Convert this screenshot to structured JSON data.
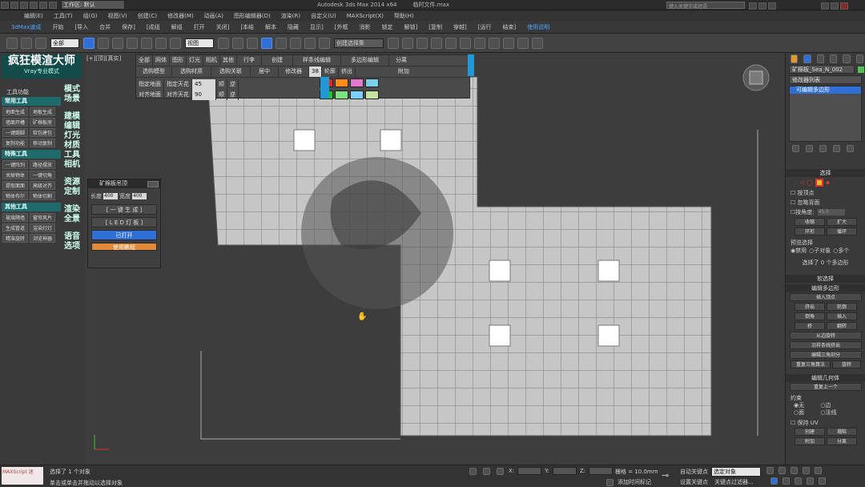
{
  "titlebar": {
    "workspace": "工作区: 默认",
    "app": "Autodesk 3ds Max  2014 x64",
    "file": "临时文件.max",
    "search_placeholder": "键入关键字或短语"
  },
  "menu": [
    "编辑(E)",
    "工具(T)",
    "组(G)",
    "视图(V)",
    "创建(C)",
    "修改器(M)",
    "动画(A)",
    "图形编辑器(D)",
    "渲染(R)",
    "自定义(U)",
    "MAXScript(X)",
    "帮助(H)"
  ],
  "ribbon": [
    "开始",
    "[导入",
    "合并",
    "保存]",
    "[成组",
    "解组",
    "打开",
    "关闭]",
    "[本结",
    "解本",
    "隐藏",
    "显示]",
    "[外框",
    "消影",
    "锁定",
    "解锁]",
    "[复制",
    "穿越]",
    "[运行",
    "结束]"
  ],
  "ribbon_brand": "3dMax速成",
  "ribbon_extra": "使用说明",
  "toolbar": {
    "filter": "全部",
    "ref": "视图",
    "selset": "创建选择集"
  },
  "brand": {
    "title": "疯狂模渲大师",
    "subtitle": "Vray专业模式"
  },
  "leftpanel": {
    "header": "工具功能",
    "sections": [
      {
        "title": "常用工具",
        "items": [
          "地面生成",
          "地板生成",
          "墙面开槽",
          "矿棉板房",
          "一键踢脚",
          "软包建包",
          "复制功能",
          "移动复制"
        ]
      },
      {
        "title": "特殊工具",
        "items": [
          "一键阵列",
          "路径摆放",
          "关联物体",
          "一键切角",
          "提取面面",
          "高级对齐",
          "物体布尔",
          "物体切割"
        ]
      },
      {
        "title": "其他工具",
        "items": [
          "玻璃隔墙",
          "窗帘风片",
          "生成管道",
          "渲染灯灯",
          "精准旋转",
          "浏览神器"
        ]
      }
    ],
    "tabs": [
      "模式\n场景",
      "建模\n编辑\n灯光\n材质\n工具\n相机",
      "资源\n定制",
      "渲染\n全景",
      "语音\n选项"
    ]
  },
  "viewport": {
    "label": "[+][顶][真实]"
  },
  "floattoolbar": {
    "row1": [
      "全部",
      "网体",
      "图形",
      "灯光",
      "相机",
      "其他",
      "行李",
      "创建",
      "样条线编辑",
      "多边形编辑",
      "分离"
    ],
    "row2": [
      "选购模型",
      "选购材质",
      "选购关联",
      "居中",
      "修改器",
      "38",
      "轮廓",
      "挤出",
      "附加"
    ],
    "row3a": [
      "指定地面",
      "指定天花",
      "45",
      "顺",
      "逆"
    ],
    "row3b": [
      "对齐地面",
      "对齐天花",
      "90",
      "顺",
      "逆"
    ],
    "swatches": [
      "#ff2020",
      "#ff8c1a",
      "#e07ad0",
      "#7ad0e6",
      "#20cc20",
      "#7fe07f",
      "#7ad0ff",
      "#c8e0a0"
    ]
  },
  "dialog": {
    "title": "矿棉板吊顶",
    "length_label": "长度",
    "length": "400",
    "width_label": "宽度",
    "width": "400",
    "btn_generate": "[ 一 键 生 成 ]",
    "btn_led": "[ L E D 灯 板 ]",
    "btn_open": "已打开",
    "btn_tutorial": "使用教程"
  },
  "rightpanel": {
    "object_name": "矿棉板_Sea_N_002",
    "modifier_list": "修改器列表",
    "stack_item": "可编辑多边形",
    "select_header": "选择",
    "by_vertex": "按顶点",
    "ignore_back": "忽略背面",
    "by_angle": "按角度:",
    "angle_value": "45.0",
    "shrink": "收缩",
    "grow": "扩大",
    "ring": "环形",
    "loop": "循环",
    "preview_sel": "预览选择",
    "preview_opts": [
      "禁用",
      "子对象",
      "多个"
    ],
    "sel_status": "选择了 0 个多边形",
    "soft_sel": "软选择",
    "edit_poly": "编辑多边形",
    "insert_vertex": "插入顶点",
    "btns": [
      "挤出",
      "轮廓",
      "倒角",
      "插入",
      "桥",
      "翻转"
    ],
    "hinge": "从边旋转",
    "extrude_spline": "沿样条线挤出",
    "edit_tri": "编辑三角剖分",
    "retri": "重复三角算法",
    "turn": "旋转",
    "edit_geo": "编辑几何体",
    "repeat_last": "重复上一个",
    "constraint": "约束",
    "constraint_opts": [
      "无",
      "边",
      "面",
      "法线"
    ],
    "keep_uv": "保持 UV",
    "create": "创建",
    "collapse": "塌陷",
    "attach": "附加",
    "detach": "分离"
  },
  "status": {
    "maxscript": "MAXScript 迷",
    "selected": "选择了 1 个对象",
    "hint": "单击或单击并拖动以选择对象",
    "grid": "栅格 = 10.0mm",
    "autokey": "自动关键点",
    "setkey": "设置关键点",
    "selobj": "选定对象",
    "keyfilter": "关键点过滤器...",
    "addtime": "添加时间标记",
    "x": "X:",
    "y": "Y:",
    "z": "Z:"
  }
}
